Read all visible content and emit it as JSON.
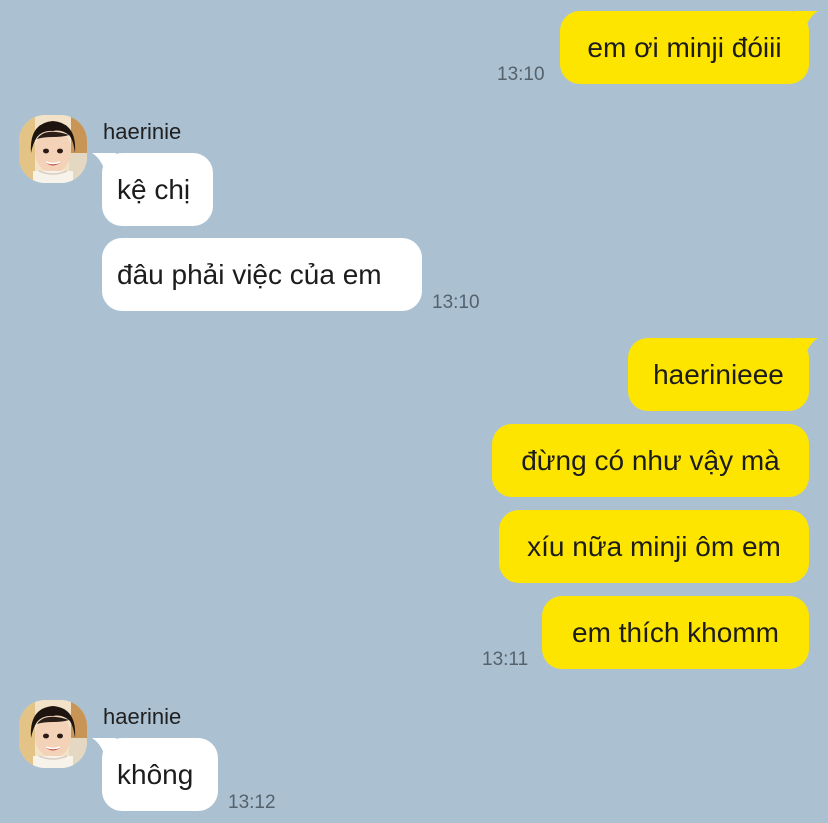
{
  "colors": {
    "background": "#abc1d2",
    "outgoing_bubble": "#fee500",
    "incoming_bubble": "#ffffff",
    "timestamp": "#55626c"
  },
  "messages": [
    {
      "direction": "outgoing",
      "text": "em ơi minji đóiii",
      "time": "13:10"
    },
    {
      "direction": "incoming",
      "sender": "haerinie",
      "text": "kệ chị"
    },
    {
      "direction": "incoming",
      "text": "đâu phải việc của em",
      "time": "13:10"
    },
    {
      "direction": "outgoing",
      "text": "haerinieee"
    },
    {
      "direction": "outgoing",
      "text": "đừng có như vậy mà"
    },
    {
      "direction": "outgoing",
      "text": "xíu nữa minji ôm em"
    },
    {
      "direction": "outgoing",
      "text": "em thích khomm",
      "time": "13:11"
    },
    {
      "direction": "incoming",
      "sender": "haerinie",
      "text": "không",
      "time": "13:12"
    }
  ],
  "avatar_icon": "child-portrait-photo"
}
